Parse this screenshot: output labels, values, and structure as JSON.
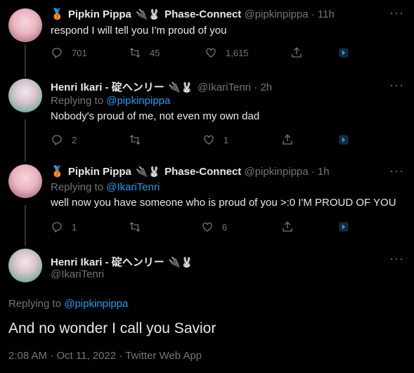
{
  "tweets": [
    {
      "name": "Pipkin Pippa",
      "badge_emoji": "🥉",
      "name_emojis": "🔌🐰",
      "org": "Phase-Connect",
      "handle": "@pipkinpippa",
      "time": "· 11h",
      "replying_prefix": "",
      "replying_to": "",
      "text": "respond I will tell you I'm proud of you",
      "reply_count": "701",
      "retweet_count": "45",
      "like_count": "1,615"
    },
    {
      "name": "Henri Ikari - 碇ヘンリー",
      "name_emojis": "🔌🐰",
      "handle": "@IkariTenri",
      "time": "· 2h",
      "replying_prefix": "Replying to",
      "replying_to": "@pipkinpippa",
      "text": "Nobody's proud of me, not even my own dad",
      "reply_count": "2",
      "retweet_count": "",
      "like_count": "1"
    },
    {
      "name": "Pipkin Pippa",
      "badge_emoji": "🥉",
      "name_emojis": "🔌🐰",
      "org": "Phase-Connect",
      "handle": "@pipkinpippa",
      "time": "· 1h",
      "replying_prefix": "Replying to",
      "replying_to": "@IkariTenri",
      "text": "well now you have someone who is proud of you >:0 I'M PROUD OF YOU",
      "reply_count": "1",
      "retweet_count": "",
      "like_count": "6"
    }
  ],
  "main_tweet": {
    "name": "Henri Ikari - 碇ヘンリー",
    "name_emojis": "🔌🐰",
    "handle": "@IkariTenri",
    "replying_prefix": "Replying to",
    "replying_to": "@pipkinpippa",
    "text": "And no wonder I call you Savior",
    "meta": "2:08 AM · Oct 11, 2022 · Twitter Web App"
  },
  "more_icon": "···",
  "colors": {
    "background": "#000000",
    "text": "#e7e9ea",
    "secondary": "#71767b",
    "link": "#1d9bf0",
    "promote": "#1d9bf0"
  },
  "icons": [
    "reply-icon",
    "retweet-icon",
    "like-icon",
    "share-icon",
    "promote-icon",
    "more-icon"
  ]
}
